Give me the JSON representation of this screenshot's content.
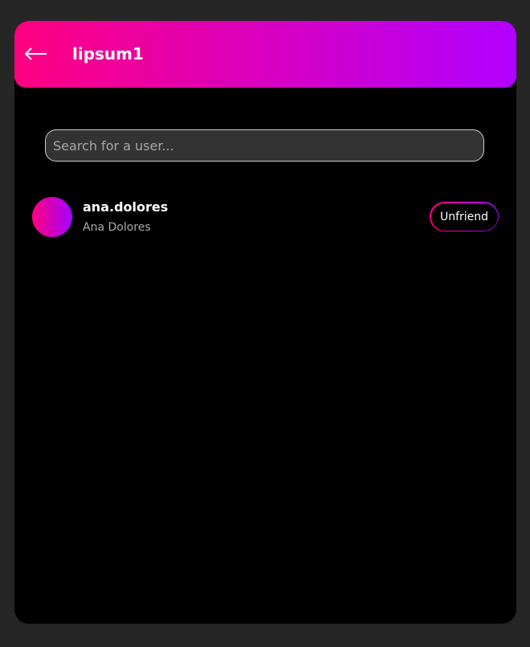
{
  "header": {
    "title": "lipsum1",
    "back_icon": "arrow-left-icon",
    "gradient_start": "#ff0080",
    "gradient_end": "#b100ff"
  },
  "search": {
    "placeholder": "Search for a user..."
  },
  "friends": [
    {
      "username": "ana.dolores",
      "full_name": "Ana Dolores",
      "action_label": "Unfriend"
    }
  ]
}
